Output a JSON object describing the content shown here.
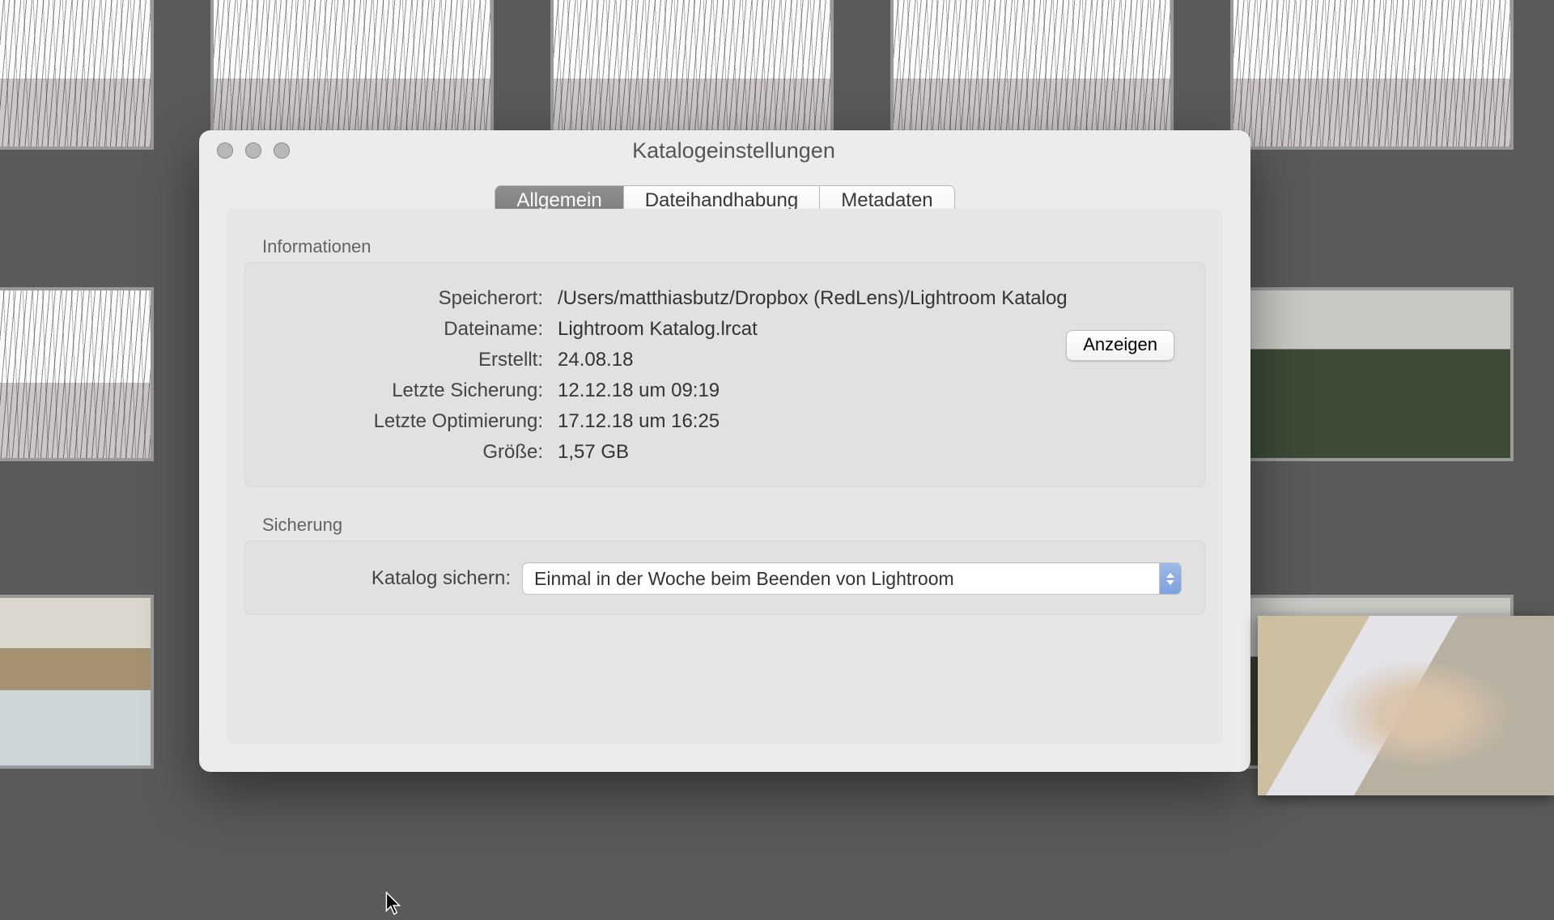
{
  "window": {
    "title": "Katalogeinstellungen"
  },
  "tabs": {
    "general": "Allgemein",
    "files": "Dateihandhabung",
    "metadata": "Metadaten",
    "active": "general"
  },
  "info": {
    "section_title": "Informationen",
    "location_label": "Speicherort:",
    "location_value": "/Users/matthiasbutz/Dropbox (RedLens)/Lightroom Katalog",
    "filename_label": "Dateiname:",
    "filename_value": "Lightroom Katalog.lrcat",
    "created_label": "Erstellt:",
    "created_value": "24.08.18",
    "lastbackup_label": "Letzte Sicherung:",
    "lastbackup_value": "12.12.18 um 09:19",
    "lastopt_label": "Letzte Optimierung:",
    "lastopt_value": "17.12.18 um 16:25",
    "size_label": "Größe:",
    "size_value": "1,57 GB",
    "show_button": "Anzeigen"
  },
  "backup": {
    "section_title": "Sicherung",
    "label": "Katalog sichern:",
    "selected": "Einmal in der Woche beim Beenden von Lightroom"
  }
}
